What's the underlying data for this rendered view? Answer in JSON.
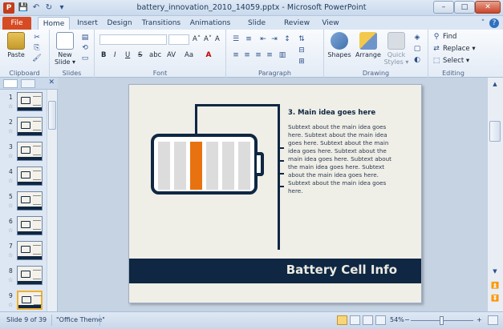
{
  "window": {
    "title": "battery_innovation_2010_14059.pptx - Microsoft PowerPoint",
    "minimize": "–",
    "maximize": "□",
    "close": "✕"
  },
  "qat": {
    "save": "💾",
    "undo": "↶",
    "redo": "↻",
    "customize": "▾"
  },
  "tabs": {
    "file": "File",
    "items": [
      "Home",
      "Insert",
      "Design",
      "Transitions",
      "Animations",
      "Slide Show",
      "Review",
      "View"
    ],
    "active": "Home"
  },
  "ribbon": {
    "clipboard": {
      "label": "Clipboard",
      "paste": "Paste"
    },
    "slides": {
      "label": "Slides",
      "new_slide": "New",
      "new_slide2": "Slide ▾"
    },
    "font": {
      "label": "Font",
      "bold": "B",
      "italic": "I",
      "underline": "U",
      "strike": "S",
      "shadow": "abc",
      "spacing": "AV",
      "case": "Aa",
      "grow": "A˄",
      "shrink": "A˅",
      "clear": "A"
    },
    "paragraph": {
      "label": "Paragraph"
    },
    "drawing": {
      "label": "Drawing",
      "shapes": "Shapes",
      "arrange": "Arrange",
      "quick_styles": "Quick",
      "quick_styles2": "Styles ▾"
    },
    "editing": {
      "label": "Editing",
      "find": "Find",
      "replace": "Replace ▾",
      "select": "Select ▾"
    }
  },
  "thumbnails": {
    "numbers": [
      "1",
      "2",
      "3",
      "4",
      "5",
      "6",
      "7",
      "8",
      "9"
    ],
    "selected": "9"
  },
  "slide": {
    "heading": "3. Main idea goes here",
    "body": "Subtext about the main idea goes here. Subtext about the main idea goes here. Subtext about the main idea goes here. Subtext about the main idea goes here. Subtext about the main idea goes here. Subtext about the main idea goes here. Subtext about the main idea goes here.",
    "banner": "Battery Cell Info"
  },
  "statusbar": {
    "slide_info": "Slide 9 of 39",
    "theme": "\"Office Theme\"",
    "zoom": "54%",
    "zoom_minus": "−",
    "zoom_plus": "+"
  }
}
